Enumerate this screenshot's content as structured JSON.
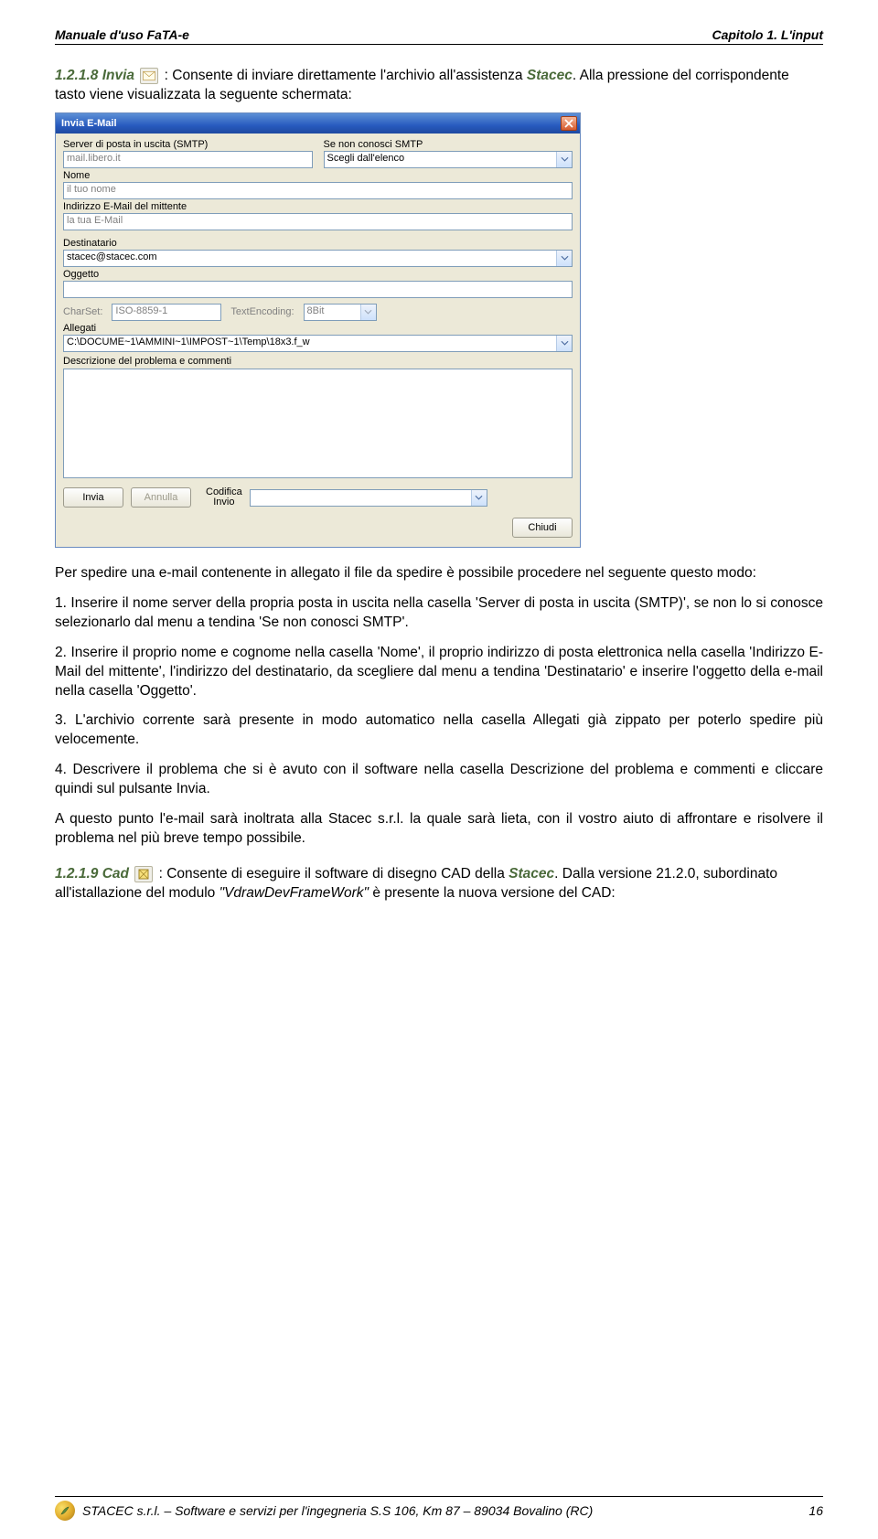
{
  "header": {
    "left": "Manuale d'uso FaTA-e",
    "right": "Capitolo 1. L'input"
  },
  "sec_invia": {
    "num": "1.2.1.8 Invia",
    "text_a": " : Consente di inviare direttamente l'archivio all'assistenza ",
    "stacec": "Stacec",
    "text_b": ". Alla pressione del corrispondente tasto viene visualizzata la seguente schermata:"
  },
  "dlg": {
    "title": "Invia E-Mail",
    "smtp_label": "Server di posta in uscita (SMTP)",
    "smtp_value": "mail.libero.it",
    "nosmtp_label": "Se non conosci SMTP",
    "nosmtp_value": "Scegli dall'elenco",
    "nome_label": "Nome",
    "nome_value": "il tuo nome",
    "mittente_label": "Indirizzo E-Mail del mittente",
    "mittente_value": "la tua E-Mail",
    "dest_label": "Destinatario",
    "dest_value": "stacec@stacec.com",
    "oggetto_label": "Oggetto",
    "oggetto_value": "",
    "charset_label": "CharSet:",
    "charset_value": "ISO-8859-1",
    "textenc_label": "TextEncoding:",
    "textenc_value": "8Bit",
    "allegati_label": "Allegati",
    "allegati_value": "C:\\DOCUME~1\\AMMINI~1\\IMPOST~1\\Temp\\18x3.f_w",
    "descr_label": "Descrizione del problema e commenti",
    "btn_invia": "Invia",
    "btn_annulla": "Annulla",
    "codifica_a": "Codifica",
    "codifica_b": "Invio",
    "btn_chiudi": "Chiudi"
  },
  "p_intro": "Per spedire una e-mail contenente in allegato il file da spedire è possibile procedere nel seguente questo modo:",
  "p1": "1. Inserire il nome server della propria posta in uscita nella casella 'Server di posta in uscita (SMTP)', se non lo si conosce selezionarlo dal menu a tendina 'Se non conosci SMTP'.",
  "p2": "2. Inserire il proprio nome e cognome nella casella 'Nome', il proprio indirizzo di posta elettronica nella casella 'Indirizzo E-Mail del mittente', l'indirizzo del destinatario, da scegliere dal menu a tendina 'Destinatario' e inserire l'oggetto della e-mail nella casella 'Oggetto'.",
  "p3": "3. L'archivio corrente sarà presente in modo automatico nella casella Allegati già zippato per poterlo spedire più velocemente.",
  "p4": "4. Descrivere il problema che si è avuto con il software nella casella Descrizione del problema e commenti e cliccare quindi sul pulsante Invia.",
  "p5": "A questo punto l'e-mail sarà inoltrata alla Stacec s.r.l. la quale sarà lieta, con il vostro aiuto di affrontare e risolvere il problema nel più breve tempo possibile.",
  "sec_cad": {
    "num": "1.2.1.9 Cad",
    "text_a": " : Consente di eseguire il software di disegno CAD della ",
    "stacec": "Stacec",
    "text_b": ". Dalla versione 21.2.0, subordinato all'istallazione del modulo ",
    "mod": "\"VdrawDevFrameWork\"",
    "text_c": " è presente la nuova versione del CAD:"
  },
  "footer": {
    "company": "STACEC s.r.l. – Software e servizi per l'ingegneria   S.S 106, Km 87 – 89034 Bovalino (RC)",
    "page": "16"
  }
}
